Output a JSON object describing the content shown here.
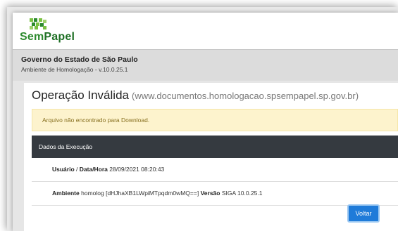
{
  "brand": {
    "logo_text_part1": "Sem",
    "logo_text_part2": "Papel",
    "logo_icon": "green-mosaic-logo-icon",
    "colors": {
      "green": "#2d8a2e",
      "light_green": "#7bc142"
    }
  },
  "header": {
    "government": "Governo do Estado de São Paulo",
    "environment": "Ambiente de Homologação - v.10.0.25.1"
  },
  "main": {
    "title": "Operação Inválida",
    "url": "(www.documentos.homologacao.spsempapel.sp.gov.br)",
    "alert_text": "Arquivo não encontrado para Download.",
    "panel_title": "Dados da Execução",
    "row1": {
      "usuario_label": "Usuário",
      "separator": " / ",
      "datahora_label": "Data/Hora",
      "datahora_value": "28/09/2021 08:20:43"
    },
    "row2": {
      "ambiente_label": "Ambiente",
      "ambiente_value": "homolog [dHJhaXB1LWpiMTpqdm0wMQ==]",
      "versao_label": "Versão",
      "versao_value": "SIGA 10.0.25.1"
    },
    "back_button": "Voltar",
    "colors": {
      "alert_bg": "#fdf3cd",
      "panel_header_bg": "#353a40",
      "button_bg": "#1f7bd9"
    }
  }
}
